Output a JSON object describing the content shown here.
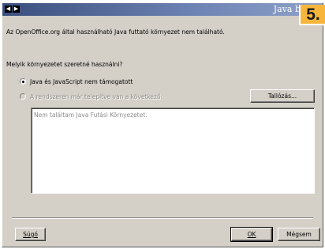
{
  "window": {
    "title": "Java b",
    "badge": "5."
  },
  "message": "Az OpenOffice.org által használható Java futtató környezet nem található.",
  "question": "Melyik környezetet szeretné használni?",
  "options": [
    {
      "label": "Java és JavaScript nem támogatott",
      "selected": true,
      "enabled": true
    },
    {
      "label": "A rendszeren már telepítve van a következő:",
      "selected": false,
      "enabled": false
    }
  ],
  "browse_button": {
    "label": "Tallózás..."
  },
  "environment_list": {
    "items": [
      "Nem találtam Java Futási Környezetet."
    ]
  },
  "buttons": {
    "help": "Súgó",
    "ok": "OK",
    "cancel": "Mégsem"
  }
}
